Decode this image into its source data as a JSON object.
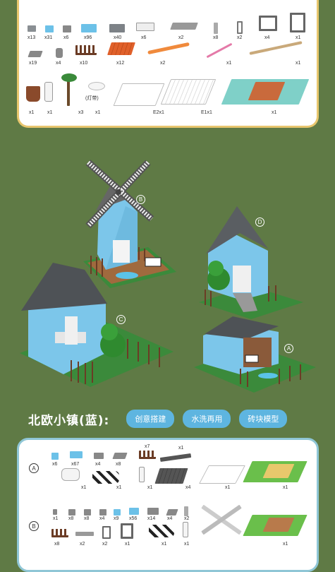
{
  "parts_top": {
    "row1_qty": [
      "x13",
      "x31",
      "x6",
      "x96",
      "x40",
      "x6",
      "x2",
      "x8",
      "x2",
      "x4",
      "x1"
    ],
    "row2_qty": [
      "x19",
      "x4",
      "x10",
      "x12",
      "x2",
      "x1",
      "x1"
    ],
    "row3_qty": [
      "x1",
      "x1",
      "x3",
      "x1",
      "E2x1",
      "E1x1",
      "x1"
    ],
    "lamp_label": "(灯带)"
  },
  "scene_markers": [
    "B",
    "D",
    "C",
    "A"
  ],
  "title": "北欧小镇(蓝):",
  "tags": [
    "创意搭建",
    "水洗再用",
    "砖块模型"
  ],
  "kit_a": {
    "label": "A",
    "top_qty": [
      "x6",
      "x67",
      "x4",
      "x8",
      "x7",
      "x1"
    ],
    "bottom_qty": [
      "x1",
      "x1",
      "x1",
      "x4",
      "x1",
      "x1"
    ]
  },
  "kit_b": {
    "label": "B",
    "top_qty": [
      "x1",
      "x8",
      "x8",
      "x4",
      "x9",
      "x56",
      "x14",
      "x4",
      "x2"
    ],
    "bottom_qty": [
      "x8",
      "x2",
      "x2",
      "x1",
      "x1",
      "x1",
      "x1"
    ]
  },
  "colors": {
    "background": "#5f7a45",
    "top_border": "#e8c66e",
    "bottom_border": "#8fc6d6",
    "tag": "#5eb5e0",
    "brick_blue": "#6cc1e8",
    "roof": "#555a5e"
  }
}
